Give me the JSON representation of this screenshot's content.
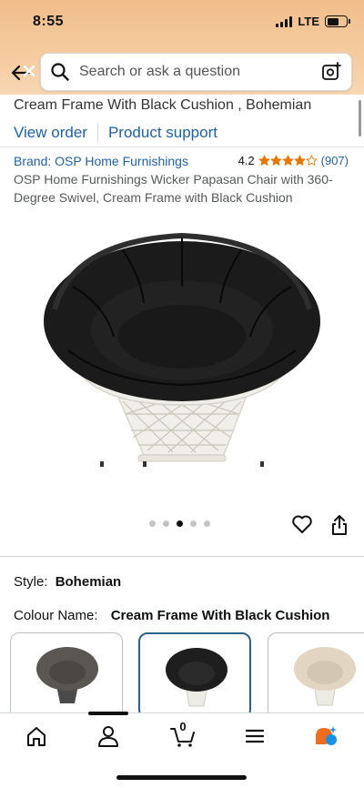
{
  "status_bar": {
    "time": "8:55",
    "network": "LTE"
  },
  "search": {
    "placeholder": "Search or ask a question"
  },
  "order": {
    "title_fragment": "Cream Frame With Black Cushion , Bohemian",
    "view_order_label": "View order",
    "product_support_label": "Product support"
  },
  "product": {
    "brand_label": "Brand: OSP Home Furnishings",
    "rating": "4.2",
    "rating_value": 4.2,
    "review_count": "(907)",
    "title": "OSP Home Furnishings Wicker Papasan Chair with 360-Degree Swivel, Cream Frame with Black Cushion",
    "image_count": 5,
    "active_image_index": 2
  },
  "variations": {
    "style_label": "Style:",
    "style_value": "Bohemian",
    "colour_label": "Colour Name:",
    "colour_value": "Cream Frame With Black Cushion",
    "swatches": [
      {
        "name": "grey-cushion",
        "cushion_color": "#5a5752",
        "selected": false
      },
      {
        "name": "black-cushion",
        "cushion_color": "#1e1e1e",
        "selected": true
      },
      {
        "name": "cream-cushion",
        "cushion_color": "#e2d6c3",
        "selected": false
      }
    ]
  },
  "bottom_nav": {
    "items": [
      "home-icon",
      "account-icon",
      "cart-icon",
      "menu-icon",
      "rufus-icon"
    ],
    "cart_count": "0",
    "active_index": 1
  },
  "colors": {
    "header_top": "#f1be8a",
    "link_blue": "#2162a1",
    "star_orange": "#e77600",
    "selected_swatch_border": "#2c6189"
  }
}
